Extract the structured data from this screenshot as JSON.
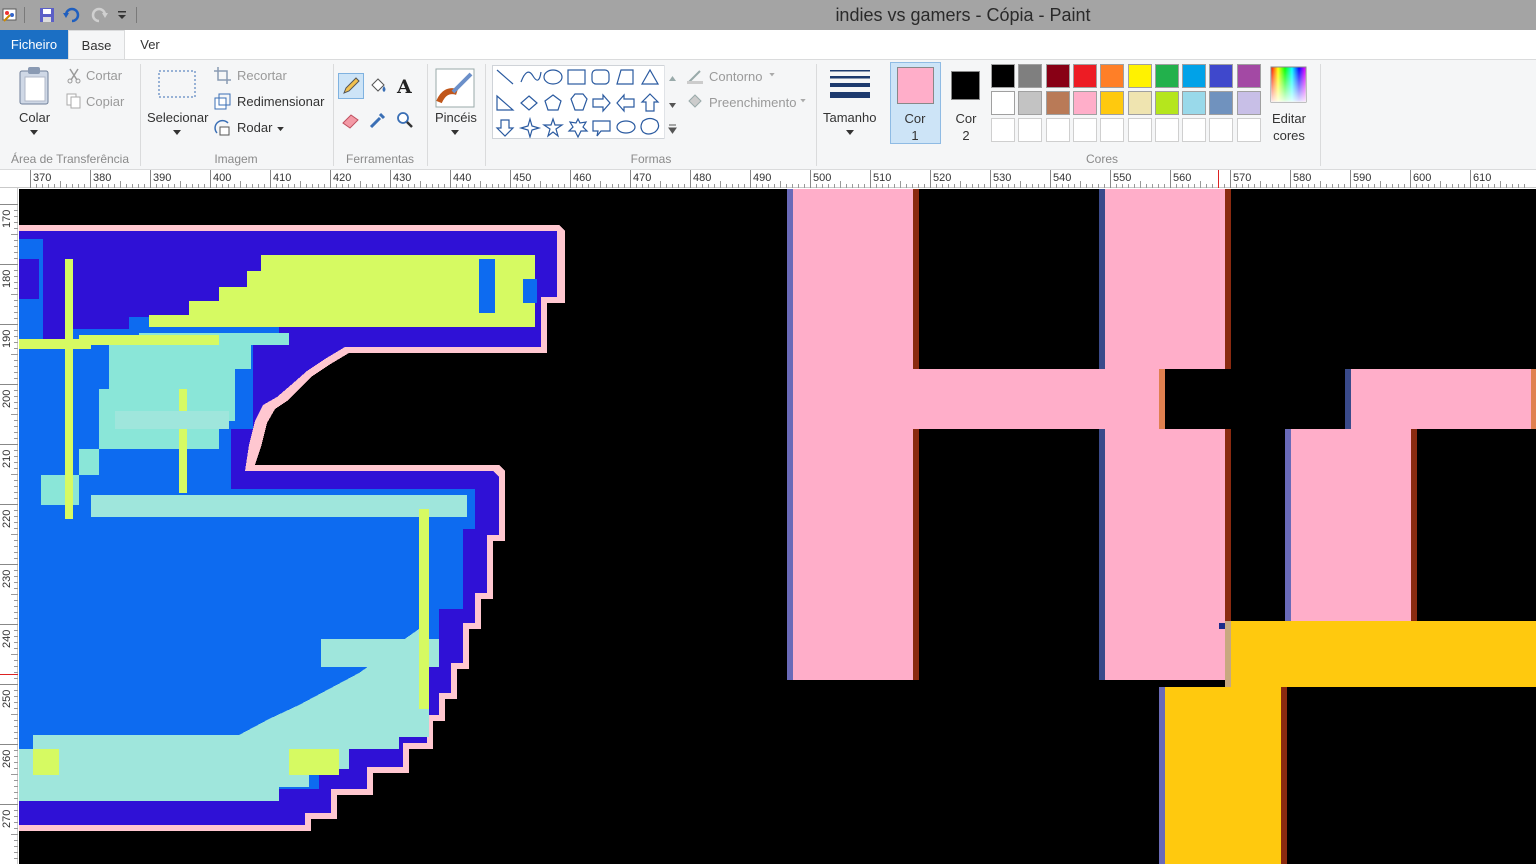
{
  "window": {
    "title": "indies vs gamers - Cópia - Paint"
  },
  "quick_access": {
    "icons": [
      "paint-app-icon",
      "save-icon",
      "undo-icon",
      "redo-icon",
      "customize-quick-access-icon"
    ]
  },
  "tabs": {
    "file": "Ficheiro",
    "home": "Base",
    "view": "Ver"
  },
  "ribbon": {
    "clipboard": {
      "paste": "Colar",
      "cut": "Cortar",
      "copy": "Copiar",
      "group": "Área de Transferência"
    },
    "image": {
      "select": "Selecionar",
      "crop": "Recortar",
      "resize": "Redimensionar",
      "rotate": "Rodar",
      "group": "Imagem"
    },
    "tools": {
      "group": "Ferramentas"
    },
    "brushes": {
      "label": "Pincéis"
    },
    "shapes": {
      "outline": "Contorno",
      "fill": "Preenchimento",
      "group": "Formas"
    },
    "size": {
      "label": "Tamanho"
    },
    "colors": {
      "color1": "Cor 1",
      "color2": "Cor 2",
      "edit": "Editar cores",
      "group": "Cores",
      "color1_value": "#ffaec9",
      "color2_value": "#000000",
      "palette_row1": [
        "#000000",
        "#7f7f7f",
        "#880015",
        "#ed1c24",
        "#ff7f27",
        "#fff200",
        "#22b14c",
        "#00a2e8",
        "#3f48cc",
        "#a349a4"
      ],
      "palette_row2": [
        "#ffffff",
        "#c3c3c3",
        "#b97a57",
        "#ffaec9",
        "#ffc90e",
        "#efe4b0",
        "#b5e61d",
        "#99d9ea",
        "#7092be",
        "#c8bfe7"
      ]
    }
  },
  "ruler": {
    "horizontal": [
      "370",
      "380",
      "390",
      "400",
      "410",
      "420",
      "430",
      "440",
      "450",
      "460",
      "470",
      "480",
      "490",
      "500",
      "510",
      "520",
      "530",
      "540",
      "550",
      "560",
      "570",
      "580",
      "590",
      "600",
      "610"
    ],
    "vertical": [
      "170",
      "180",
      "190",
      "200",
      "210",
      "220",
      "230",
      "240",
      "250",
      "260",
      "270"
    ]
  }
}
